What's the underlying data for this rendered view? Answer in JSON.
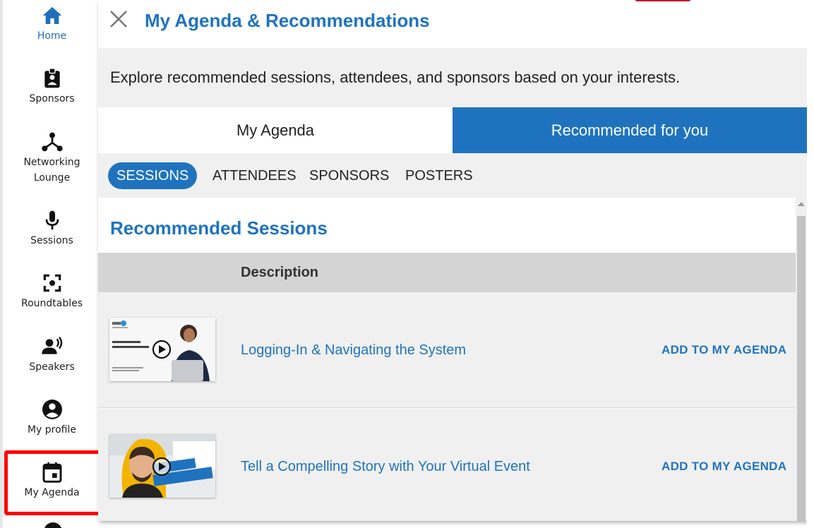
{
  "sidebar": {
    "items": [
      {
        "label": "Home",
        "icon": "home-icon"
      },
      {
        "label": "Sponsors",
        "icon": "badge-icon"
      },
      {
        "label": "Networking Lounge",
        "icon": "network-icon"
      },
      {
        "label": "Sessions",
        "icon": "microphone-icon"
      },
      {
        "label": "Roundtables",
        "icon": "roundtable-icon"
      },
      {
        "label": "Speakers",
        "icon": "speaker-icon"
      },
      {
        "label": "My profile",
        "icon": "profile-icon"
      },
      {
        "label": "My Agenda",
        "icon": "calendar-icon"
      }
    ],
    "active": "Home",
    "highlighted": "My Agenda"
  },
  "panel": {
    "title": "My Agenda & Recommendations",
    "intro": "Explore recommended sessions, attendees, and sponsors based on your interests.",
    "tabs": [
      {
        "label": "My Agenda"
      },
      {
        "label": "Recommended for you"
      }
    ],
    "active_tab": "Recommended for you",
    "subtabs": [
      {
        "label": "SESSIONS"
      },
      {
        "label": "ATTENDEES"
      },
      {
        "label": "SPONSORS"
      },
      {
        "label": "POSTERS"
      }
    ],
    "active_subtab": "SESSIONS",
    "section_title": "Recommended Sessions",
    "table_header": "Description",
    "sessions": [
      {
        "title": "Logging-In & Navigating the System",
        "action": "ADD TO MY AGENDA"
      },
      {
        "title": "Tell a Compelling Story with Your Virtual Event",
        "action": "ADD TO MY AGENDA"
      }
    ]
  },
  "colors": {
    "accent": "#1f73be",
    "highlight": "#ff0000"
  }
}
